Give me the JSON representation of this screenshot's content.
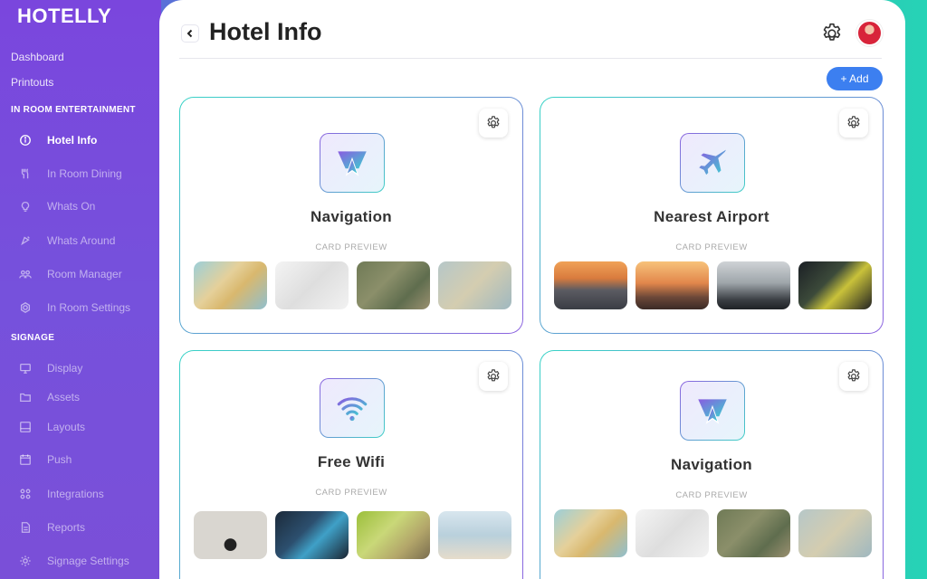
{
  "brand": "HOTELLY",
  "sidebar": {
    "top_links": [
      "Dashboard",
      "Printouts"
    ],
    "sections": [
      {
        "title": "IN ROOM ENTERTAINMENT",
        "items": [
          {
            "label": "Hotel Info",
            "icon": "info-icon",
            "active": true
          },
          {
            "label": "In Room Dining",
            "icon": "fork-knife-icon"
          },
          {
            "label": "Whats On",
            "icon": "lightbulb-icon"
          },
          {
            "label": "Whats Around",
            "icon": "location-icon"
          },
          {
            "label": "Room Manager",
            "icon": "users-icon"
          },
          {
            "label": "In Room Settings",
            "icon": "settings-icon"
          }
        ]
      },
      {
        "title": "SIGNAGE",
        "items": [
          {
            "label": "Display",
            "icon": "monitor-icon"
          },
          {
            "label": "Assets",
            "icon": "folder-icon"
          },
          {
            "label": "Layouts",
            "icon": "layout-icon"
          },
          {
            "label": "Push",
            "icon": "calendar-icon"
          },
          {
            "label": "Integrations",
            "icon": "grid-icon"
          },
          {
            "label": "Reports",
            "icon": "document-icon"
          },
          {
            "label": "Signage Settings",
            "icon": "gear-icon"
          }
        ]
      }
    ]
  },
  "header": {
    "title": "Hotel Info",
    "add_label": "+ Add"
  },
  "cards": [
    {
      "title": "Navigation",
      "icon": "navigation-icon",
      "preview_label": "CARD PREVIEW"
    },
    {
      "title": "Nearest Airport",
      "icon": "airplane-icon",
      "preview_label": "CARD PREVIEW"
    },
    {
      "title": "Free Wifi",
      "icon": "wifi-icon",
      "preview_label": "CARD PREVIEW"
    },
    {
      "title": "Navigation",
      "icon": "navigation-icon",
      "preview_label": "CARD PREVIEW"
    }
  ],
  "colors": {
    "accent_purple": "#7a46dd",
    "accent_teal": "#2ec9b6",
    "add_button": "#3c7ff0"
  }
}
